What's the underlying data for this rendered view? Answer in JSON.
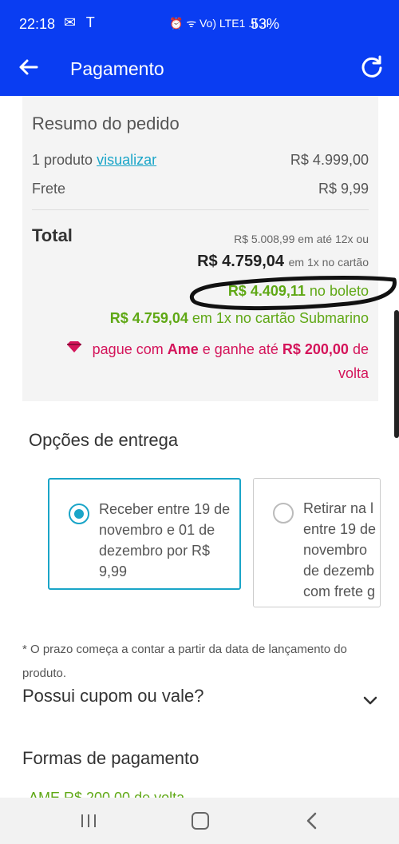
{
  "status_bar": {
    "time": "22:18",
    "left_icons": "✉ T",
    "right_icons": "⏰ ᯤ Vo) LTE1 .ıl .ıl",
    "battery": "53%"
  },
  "app_bar": {
    "title": "Pagamento",
    "back_icon": "arrow-left",
    "refresh_icon": "refresh"
  },
  "summary": {
    "title": "Resumo do pedido",
    "products_label": "1 produto",
    "products_link": "visualizar",
    "products_value": "R$ 4.999,00",
    "shipping_label": "Frete",
    "shipping_value": "R$ 9,99",
    "total_label": "Total",
    "installment_text": "R$ 5.008,99 em até 12x ou",
    "card_price": "R$ 4.759,04",
    "card_suffix": "em 1x no cartão",
    "boleto_price": "R$ 4.409,11",
    "boleto_suffix": "no boleto",
    "sub_card_price": "R$ 4.759,04",
    "sub_card_suffix": "em 1x no cartão Submarino",
    "ame_prefix": "pague com",
    "ame_brand": "Ame",
    "ame_middle": "e ganhe até",
    "ame_value": "R$ 200,00",
    "ame_suffix": "de volta"
  },
  "delivery": {
    "title": "Opções de entrega",
    "option_selected": "Receber entre 19 de novembro e 01 de dezembro por R$ 9,99",
    "option_pickup_lines": [
      "Retirar na l",
      "entre 19 de",
      "novembro",
      "de dezemb",
      "com frete g"
    ]
  },
  "note": "* O prazo começa a contar a partir da data de lançamento do produto.",
  "coupon": {
    "label": "Possui cupom ou vale?"
  },
  "payment": {
    "title": "Formas de pagamento",
    "peek_text": "AME R$ 200,00 de volta"
  },
  "colors": {
    "primary": "#0a3df2",
    "accent": "#1aa5c8",
    "green": "#5fa815",
    "ame": "#d4145a"
  }
}
